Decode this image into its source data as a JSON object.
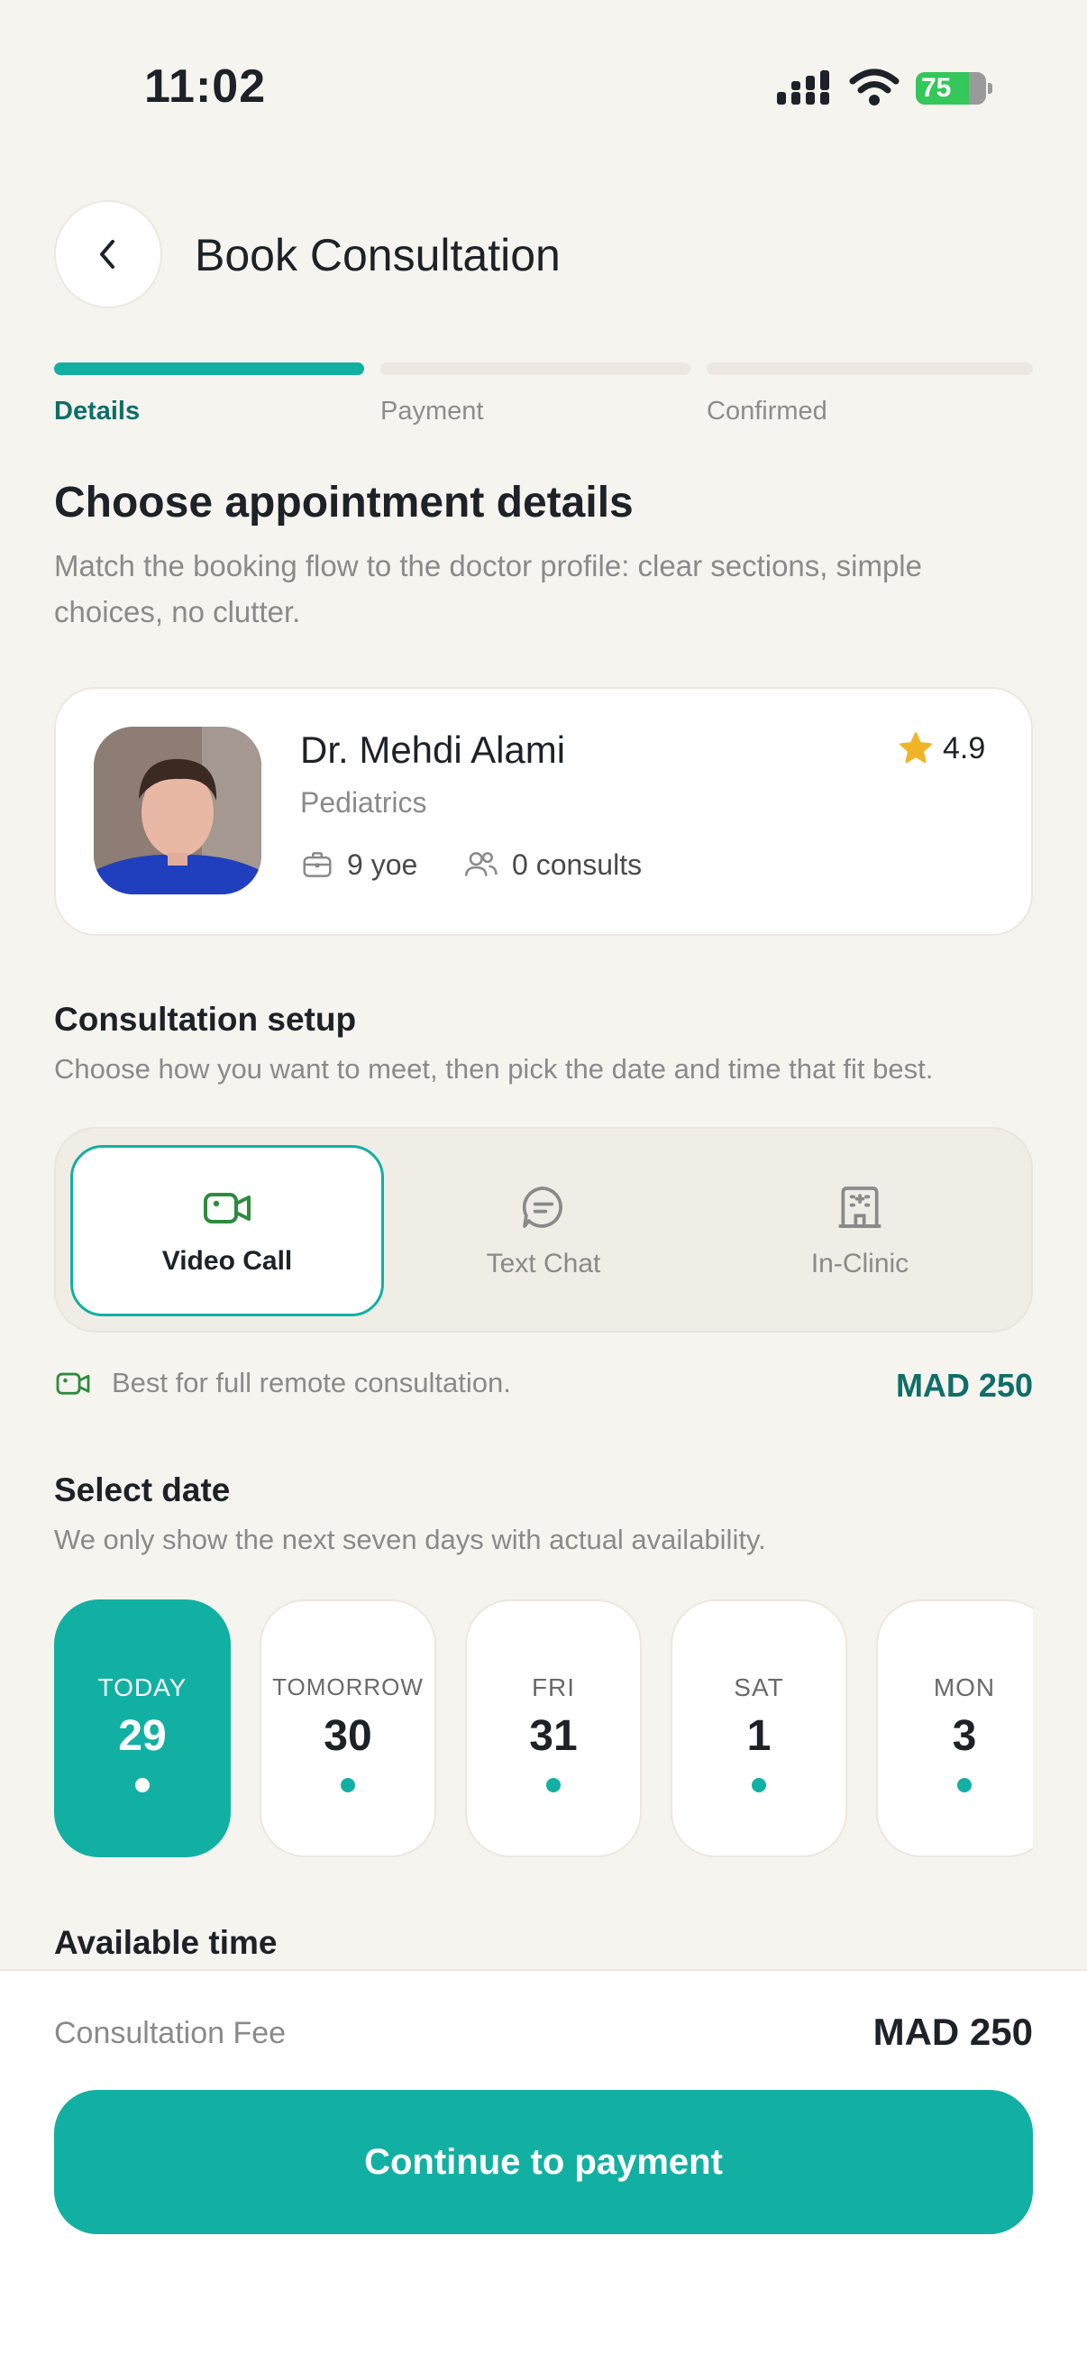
{
  "status_bar": {
    "time": "11:02",
    "battery_percent": 75,
    "battery_label": "75"
  },
  "header": {
    "title": "Book Consultation"
  },
  "stepper": {
    "steps": [
      {
        "label": "Details",
        "active": true
      },
      {
        "label": "Payment",
        "active": false
      },
      {
        "label": "Confirmed",
        "active": false
      }
    ]
  },
  "intro": {
    "title": "Choose appointment details",
    "subtitle": "Match the booking flow to the doctor profile: clear sections, simple choices, no clutter."
  },
  "doctor": {
    "name": "Dr. Mehdi Alami",
    "specialty": "Pediatrics",
    "rating": "4.9",
    "experience": "9 yoe",
    "consults": "0 consults"
  },
  "setup": {
    "title": "Consultation setup",
    "subtitle": "Choose how you want to meet, then pick the date and time that fit best.",
    "types": [
      {
        "label": "Video Call",
        "icon": "video-camera-icon",
        "selected": true
      },
      {
        "label": "Text Chat",
        "icon": "chat-bubble-icon",
        "selected": false
      },
      {
        "label": "In-Clinic",
        "icon": "building-icon",
        "selected": false
      }
    ],
    "note": "Best for full remote consultation.",
    "price": "MAD 250"
  },
  "date_section": {
    "title": "Select date",
    "subtitle": "We only show the next seven days with actual availability.",
    "dates": [
      {
        "weekday": "TODAY",
        "day": "29",
        "selected": true
      },
      {
        "weekday": "TOMORROW",
        "day": "30",
        "selected": false
      },
      {
        "weekday": "FRI",
        "day": "31",
        "selected": false
      },
      {
        "weekday": "SAT",
        "day": "1",
        "selected": false
      },
      {
        "weekday": "MON",
        "day": "3",
        "selected": false
      }
    ]
  },
  "time_section": {
    "title": "Available time"
  },
  "footer": {
    "fee_label": "Consultation Fee",
    "fee_value": "MAD 250",
    "cta_label": "Continue to payment"
  },
  "colors": {
    "accent": "#12b0a2",
    "accent_dark": "#0f6f68",
    "background": "#f6f4ef",
    "star": "#f0b429"
  }
}
